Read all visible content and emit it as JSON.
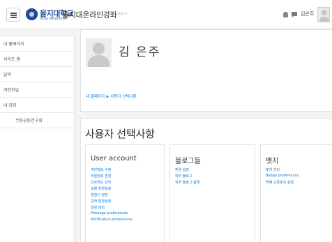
{
  "navbar": {
    "brand": "을지대학교",
    "brand_sub": "EULJI UNIVERSITY",
    "site_title": "을지대온라인강좌",
    "language": "한국어 (ko) ▾",
    "user_name": "김은주"
  },
  "sidebar": {
    "items": [
      {
        "label": "내 홈페이지"
      },
      {
        "label": "사이트 홈"
      },
      {
        "label": "달력"
      },
      {
        "label": "개인파일"
      },
      {
        "label": "내 강좌"
      },
      {
        "label": "무용공동연구회"
      }
    ]
  },
  "profile": {
    "name": "김 은주",
    "breadcrumb_home": "내 홈페이지",
    "breadcrumb_sep": "▶",
    "breadcrumb_current": "사용자 선택사항"
  },
  "main": {
    "heading": "사용자 선택사항",
    "sections": [
      {
        "title": "User account",
        "links": [
          "개인정보 수정",
          "비밀번호 변경",
          "선호하는 언어",
          "포럼 환경설정",
          "편집기 설정",
          "강좌 환경설정",
          "일정 달력",
          "Message preferences",
          "Notification preferences"
        ]
      },
      {
        "title": "블로그들",
        "links": [
          "환경 설정",
          "외부 블로그",
          "외부 블로그 등록"
        ]
      },
      {
        "title": "뱃지",
        "links": [
          "뱃지 관리",
          "Badge preferences",
          "백팩 오픈뱃지 설정"
        ]
      }
    ]
  }
}
